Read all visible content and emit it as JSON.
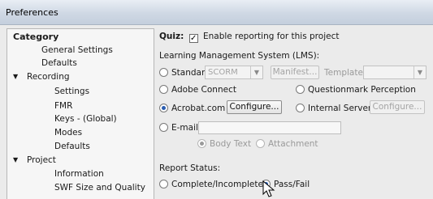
{
  "window": {
    "title": "Preferences"
  },
  "sidebar": {
    "header": "Category",
    "items": [
      {
        "label": "General Settings",
        "level": 1
      },
      {
        "label": "Defaults",
        "level": 1
      },
      {
        "label": "Recording",
        "level": 0,
        "expanded": true
      },
      {
        "label": "Settings",
        "level": 1
      },
      {
        "label": "FMR",
        "level": 1
      },
      {
        "label": "Keys - (Global)",
        "level": 1
      },
      {
        "label": "Modes",
        "level": 1
      },
      {
        "label": "Defaults",
        "level": 1
      },
      {
        "label": "Project",
        "level": 0,
        "expanded": true
      },
      {
        "label": "Information",
        "level": 1
      },
      {
        "label": "SWF Size and Quality",
        "level": 1
      }
    ]
  },
  "quiz": {
    "label": "Quiz:",
    "enable_reporting_label": "Enable reporting for this project",
    "enable_reporting_checked": true
  },
  "lms": {
    "heading": "Learning Management System (LMS):",
    "standard_label": "Standard:",
    "standard_value": "SCORM",
    "manifest_button": "Manifest...",
    "template_label": "Template:",
    "template_value": "",
    "adobe_connect_label": "Adobe Connect",
    "questionmark_label": "Questionmark Perception",
    "acrobat_label": "Acrobat.com",
    "acrobat_configure": "Configure...",
    "internal_server_label": "Internal Server",
    "internal_configure": "Configure...",
    "email_label": "E-mail:",
    "email_value": "",
    "body_text_label": "Body Text",
    "attachment_label": "Attachment",
    "selected": "Acrobat.com",
    "email_format_selected": "Body Text"
  },
  "report_status": {
    "heading": "Report Status:",
    "complete_label": "Complete/Incomplete",
    "passfail_label": "Pass/Fail",
    "selected": "Pass/Fail"
  },
  "colors": {
    "title_bar_top": "#e9eef5",
    "title_bar_bottom": "#c4cfdd",
    "radio_selected": "#2a5db0",
    "disabled_text": "#9a9a9a"
  }
}
